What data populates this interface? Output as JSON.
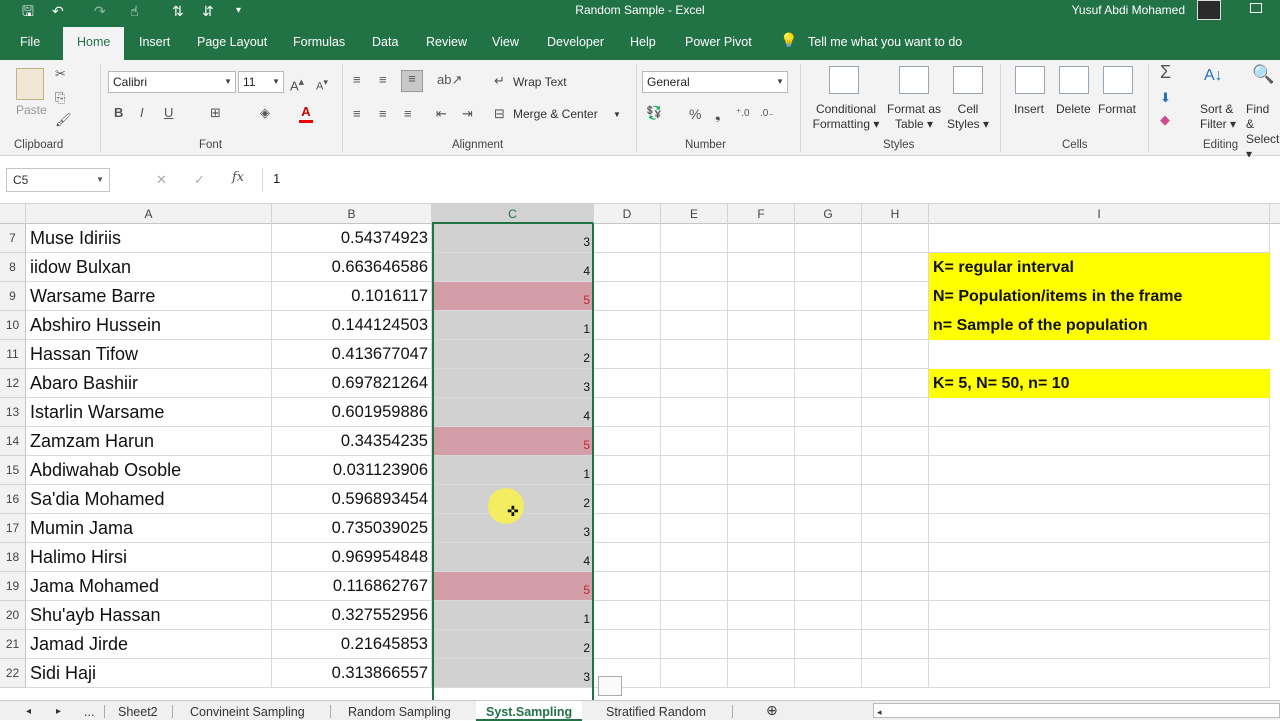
{
  "window": {
    "title": "Random Sample  -  Excel",
    "user": "Yusuf Abdi Mohamed"
  },
  "quick_access": {
    "save_icon": "save-icon",
    "undo_icon": "undo-icon",
    "redo_icon": "redo-icon"
  },
  "tabs": [
    "File",
    "Home",
    "Insert",
    "Page Layout",
    "Formulas",
    "Data",
    "Review",
    "View",
    "Developer",
    "Help",
    "Power Pivot"
  ],
  "tell_me": "Tell me what you want to do",
  "ribbon": {
    "clipboard": {
      "label": "Clipboard",
      "paste": "Paste"
    },
    "font": {
      "label": "Font",
      "name": "Calibri",
      "size": "11"
    },
    "alignment": {
      "label": "Alignment",
      "wrap": "Wrap Text",
      "merge": "Merge & Center"
    },
    "number": {
      "label": "Number",
      "format": "General"
    },
    "styles": {
      "label": "Styles",
      "conditional_1": "Conditional",
      "conditional_2": "Formatting",
      "table_1": "Format as",
      "table_2": "Table",
      "cell_1": "Cell",
      "cell_2": "Styles"
    },
    "cells": {
      "label": "Cells",
      "insert": "Insert",
      "delete": "Delete",
      "format": "Format"
    },
    "editing": {
      "label": "Editing",
      "sort_1": "Sort &",
      "sort_2": "Filter",
      "find_1": "Find &",
      "find_2": "Select"
    }
  },
  "formula_bar": {
    "name_box": "C5",
    "value": "1"
  },
  "columns": [
    "A",
    "B",
    "C",
    "D",
    "E",
    "F",
    "G",
    "H",
    "I"
  ],
  "rows": [
    {
      "num": "7",
      "a": "Muse Idiriis",
      "b": "0.54374923",
      "c": "3",
      "hl": false
    },
    {
      "num": "8",
      "a": "iidow Bulxan",
      "b": "0.663646586",
      "c": "4",
      "hl": false
    },
    {
      "num": "9",
      "a": "Warsame Barre",
      "b": "0.1016117",
      "c": "5",
      "hl": true
    },
    {
      "num": "10",
      "a": "Abshiro Hussein",
      "b": "0.144124503",
      "c": "1",
      "hl": false
    },
    {
      "num": "11",
      "a": "Hassan Tifow",
      "b": "0.413677047",
      "c": "2",
      "hl": false
    },
    {
      "num": "12",
      "a": "Abaro Bashiir",
      "b": "0.697821264",
      "c": "3",
      "hl": false
    },
    {
      "num": "13",
      "a": "Istarlin Warsame",
      "b": "0.601959886",
      "c": "4",
      "hl": false
    },
    {
      "num": "14",
      "a": "Zamzam Harun",
      "b": "0.34354235",
      "c": "5",
      "hl": true
    },
    {
      "num": "15",
      "a": "Abdiwahab Osoble",
      "b": "0.031123906",
      "c": "1",
      "hl": false
    },
    {
      "num": "16",
      "a": "Sa'dia Mohamed",
      "b": "0.596893454",
      "c": "2",
      "hl": false
    },
    {
      "num": "17",
      "a": "Mumin Jama",
      "b": "0.735039025",
      "c": "3",
      "hl": false
    },
    {
      "num": "18",
      "a": "Halimo Hirsi",
      "b": "0.969954848",
      "c": "4",
      "hl": false
    },
    {
      "num": "19",
      "a": "Jama Mohamed",
      "b": "0.116862767",
      "c": "5",
      "hl": true
    },
    {
      "num": "20",
      "a": "Shu'ayb Hassan",
      "b": "0.327552956",
      "c": "1",
      "hl": false
    },
    {
      "num": "21",
      "a": "Jamad Jirde",
      "b": "0.21645853",
      "c": "2",
      "hl": false
    },
    {
      "num": "22",
      "a": "Sidi Haji",
      "b": "0.313866557",
      "c": "3",
      "hl": false
    }
  ],
  "notes": [
    {
      "text": "K= regular interval",
      "blank": false
    },
    {
      "text": "N= Population/items in the frame",
      "blank": false
    },
    {
      "text": "n= Sample of the population",
      "blank": false
    },
    {
      "text": "",
      "blank": true
    },
    {
      "text": "K= 5,   N= 50,   n= 10",
      "blank": false
    }
  ],
  "sheet_tabs": [
    "Sheet2",
    "Convineint Sampling",
    "Random Sampling",
    "Syst.Sampling",
    "Stratified Random"
  ],
  "active_sheet": "Syst.Sampling",
  "colors": {
    "excel_green": "#217346",
    "highlight_red": "#d39ea7",
    "note_yellow": "#ffff00",
    "selection_gray": "#d1d1d1"
  }
}
